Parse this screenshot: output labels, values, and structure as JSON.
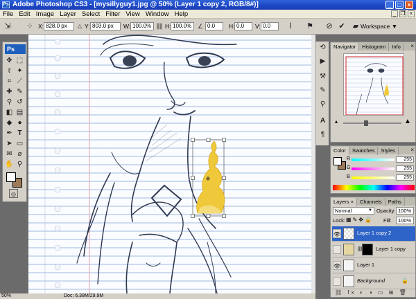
{
  "window": {
    "title": "Adobe Photoshop CS3 - [mysillyguy1.jpg @ 50% (Layer 1 copy 2, RGB/8#)]",
    "app_icon": "Ps"
  },
  "menu": [
    "File",
    "Edit",
    "Image",
    "Layer",
    "Select",
    "Filter",
    "View",
    "Window",
    "Help"
  ],
  "options_bar": {
    "x_label": "X:",
    "x_value": "828.0 px",
    "y_label": "Y:",
    "y_value": "803.0 px",
    "w_label": "W:",
    "w_value": "100.0%",
    "h_label": "H:",
    "h_value": "100.0%",
    "rot_value": "0.0",
    "h_skew_label": "H:",
    "h_skew_value": "0.0",
    "v_skew_label": "V:",
    "v_skew_value": "0.0",
    "workspace_label": "Workspace"
  },
  "tools": {
    "logo": "Ps"
  },
  "status": {
    "zoom": "50%",
    "doc_size": "Doc: 6.38M/29.9M"
  },
  "navigator": {
    "tabs": [
      "Navigator",
      "Histogram",
      "Info"
    ]
  },
  "color_panel": {
    "tabs": [
      "Color",
      "Swatches",
      "Styles"
    ],
    "channels": [
      {
        "label": "R",
        "value": "255"
      },
      {
        "label": "G",
        "value": "255"
      },
      {
        "label": "B",
        "value": "255"
      }
    ]
  },
  "layers_panel": {
    "tabs": [
      "Layers",
      "Channels",
      "Paths"
    ],
    "blend_mode": "Normal",
    "opacity_label": "Opacity:",
    "opacity_value": "100%",
    "lock_label": "Lock:",
    "fill_label": "Fill:",
    "fill_value": "100%",
    "layers": [
      {
        "name": "Layer 1 copy 2",
        "selected": true,
        "visible": true
      },
      {
        "name": "Layer 1 copy",
        "selected": false,
        "visible": false
      },
      {
        "name": "Layer 1",
        "selected": false,
        "visible": true
      },
      {
        "name": "Background",
        "selected": false,
        "visible": false
      }
    ]
  }
}
